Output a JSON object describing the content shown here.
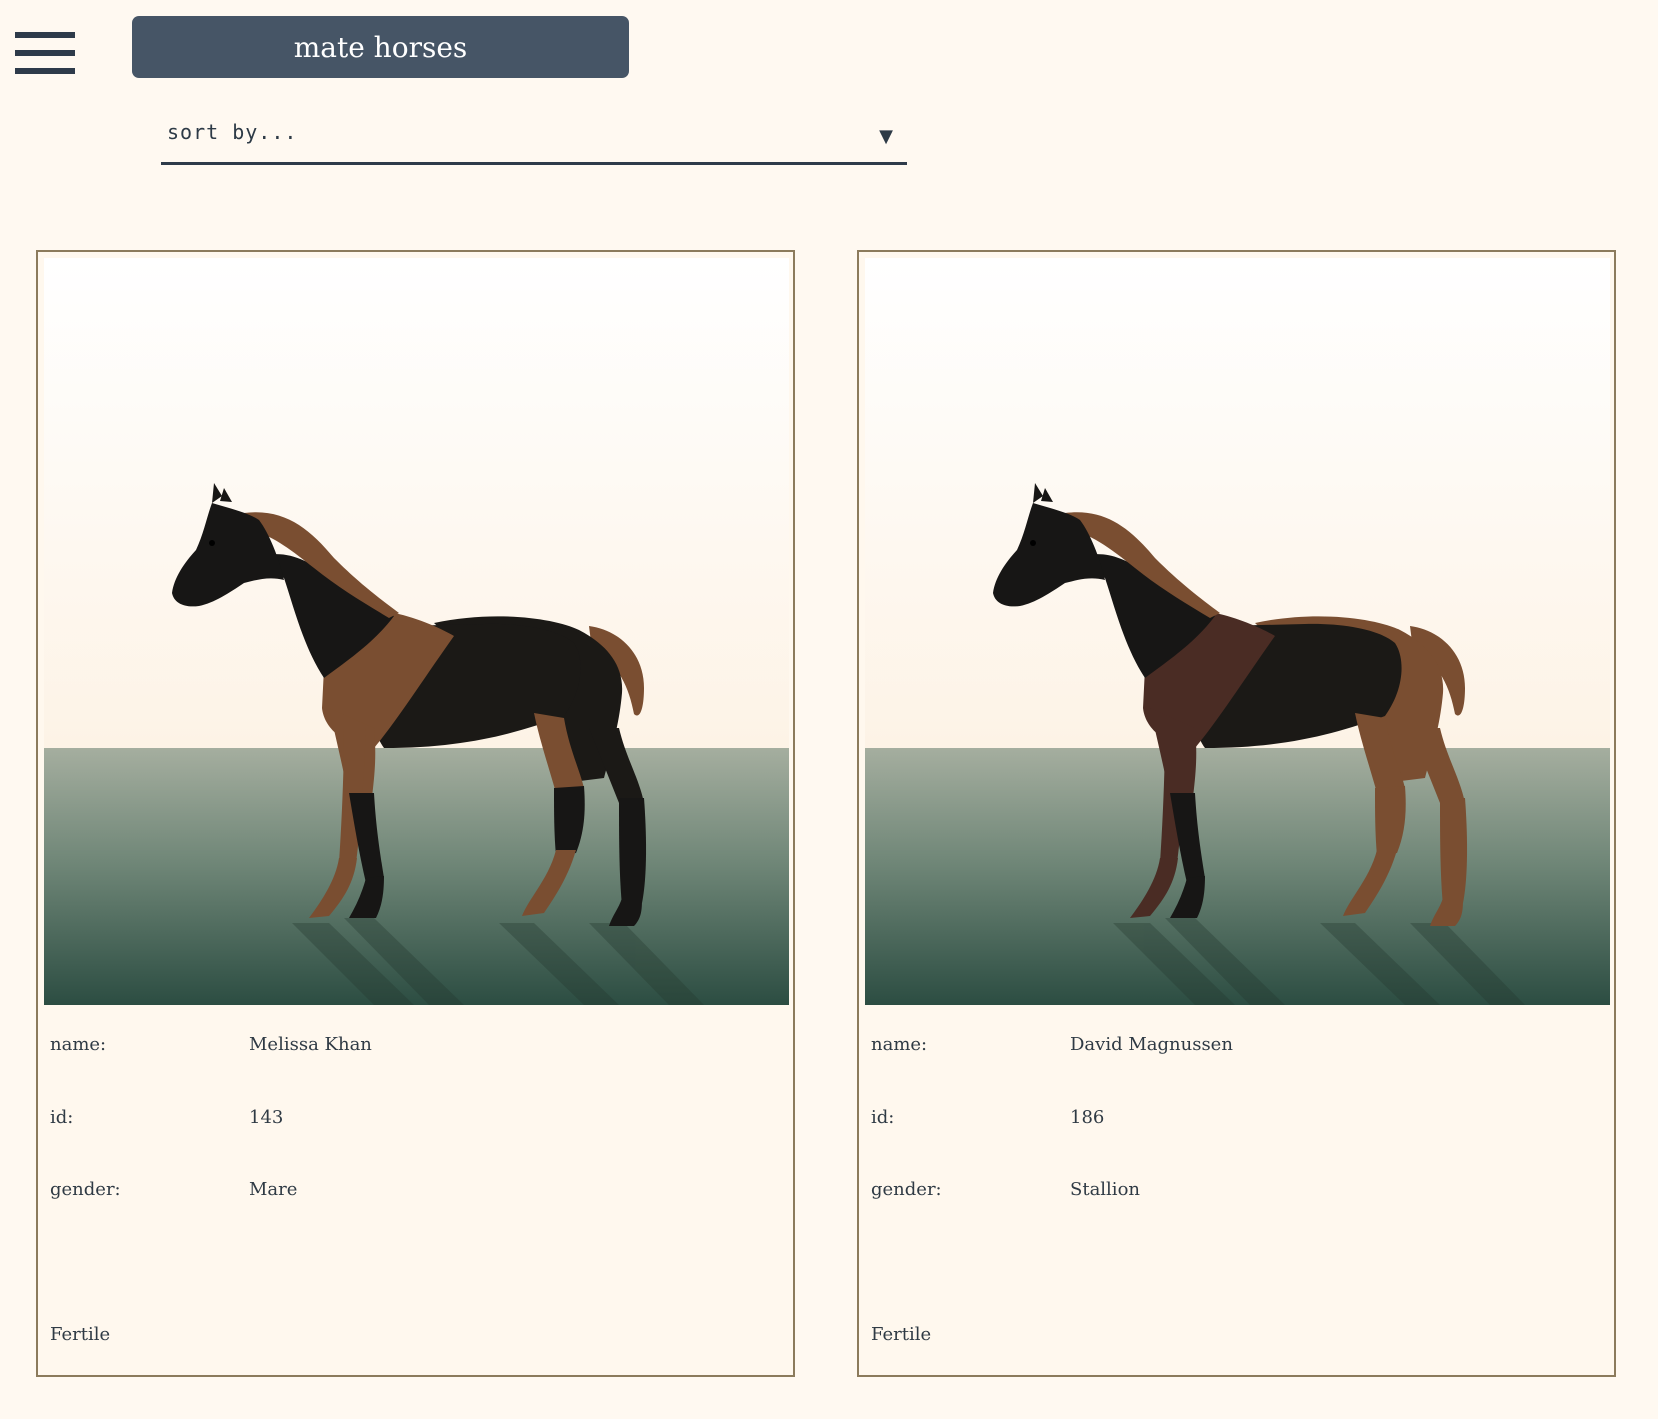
{
  "header": {
    "mate_button_label": "mate horses",
    "menu_icon": "hamburger-menu-icon"
  },
  "sort": {
    "placeholder": "sort by...",
    "arrow": "▼"
  },
  "field_labels": {
    "name": "name:",
    "id": "id:",
    "gender": "gender:"
  },
  "horses": [
    {
      "name": "Melissa Khan",
      "id": "143",
      "gender": "Mare",
      "status": "Fertile",
      "colors": {
        "head": "#171615",
        "mane": "#7a4e31",
        "neck": "#171615",
        "shoulder": "#7a4e31",
        "body": "#1b1916",
        "hind": "#1b1916",
        "tail": "#7a4e31",
        "front_upper": "#7a4e31",
        "front_lower": "#171615",
        "front_hoof": "#7a4e31",
        "rear_upper": "#7a4e31",
        "rear_lower": "#171615",
        "rear_hoof": "#7a4e31"
      }
    },
    {
      "name": "David Magnussen",
      "id": "186",
      "gender": "Stallion",
      "status": "Fertile",
      "colors": {
        "head": "#171615",
        "mane": "#7a4e31",
        "neck": "#171615",
        "shoulder": "#4a2c24",
        "body": "#1b1916",
        "hind": "#7a4e31",
        "tail": "#7a4e31",
        "front_upper": "#4a2c24",
        "front_lower": "#171615",
        "front_hoof": "#4a2c24",
        "rear_upper": "#7a4e31",
        "rear_lower": "#7a4e31",
        "rear_hoof": "#7a4e31"
      }
    }
  ]
}
